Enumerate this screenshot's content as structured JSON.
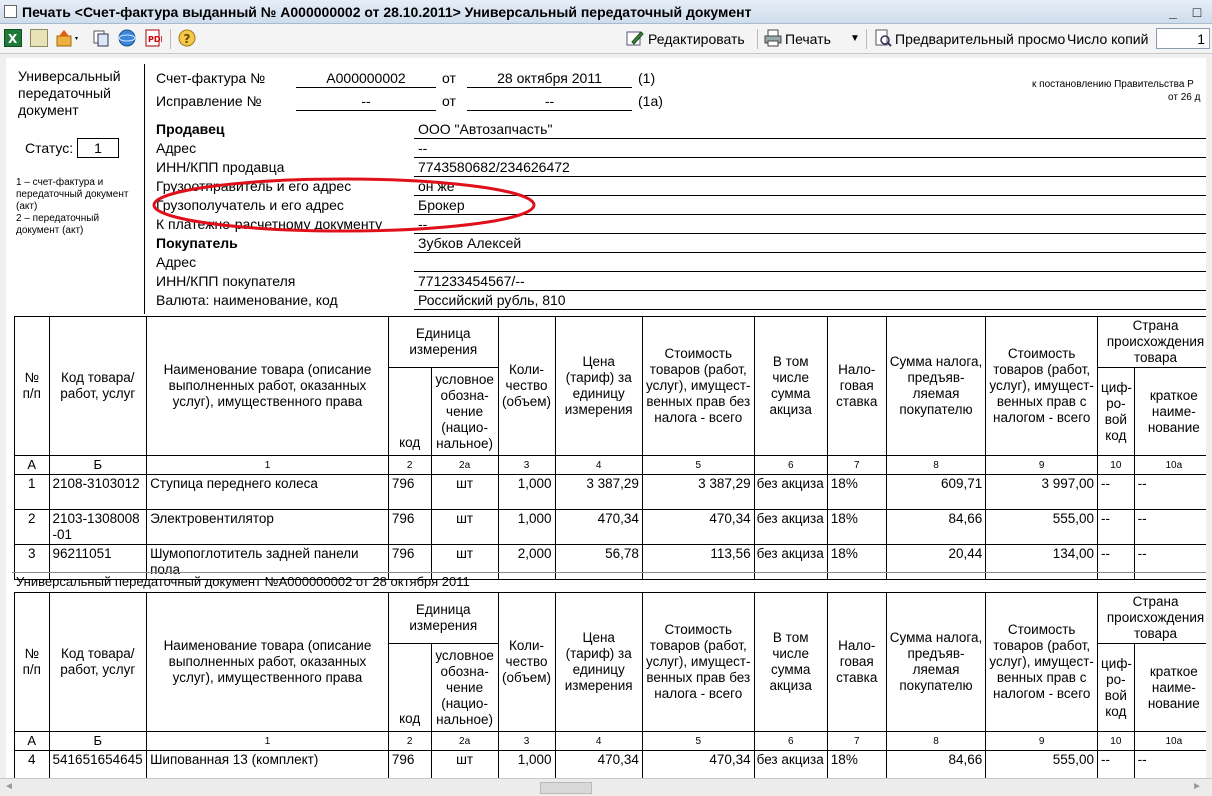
{
  "window": {
    "title": "Печать <Счет-фактура выданный № А000000002 от 28.10.2011> Универсальный передаточный документ"
  },
  "toolbar": {
    "edit_label": "Редактировать",
    "print_label": "Печать",
    "preview_label": "Предварительный просмо",
    "copies_label": "Число копий",
    "copies_value": "1"
  },
  "left": {
    "doc_type": [
      "Универсальный",
      "передаточный",
      "документ"
    ],
    "status_label": "Статус:",
    "status_value": "1",
    "note": [
      "1 – счет-фактура и",
      "передаточный документ",
      "(акт)",
      "2 – передаточный",
      "документ (акт)"
    ]
  },
  "header": {
    "invoice_label": "Счет-фактура №",
    "invoice_number": "А000000002",
    "from_label": "от",
    "invoice_date": "28 октября 2011",
    "num1": "(1)",
    "correction_label": "Исправление №",
    "correction_number": "--",
    "correction_from": "от",
    "correction_date": "--",
    "num1a": "(1а)",
    "gov_note_1": "к постановлению Правительства Р",
    "gov_note_2": "от 26 д"
  },
  "parties": [
    {
      "label": "Продавец",
      "value": "ООО \"Автозапчасть\"",
      "bold": true
    },
    {
      "label": "Адрес",
      "value": "--",
      "bold": false
    },
    {
      "label": "ИНН/КПП продавца",
      "value": "7743580682/234626472",
      "bold": false
    },
    {
      "label": "Грузоотправитель и его адрес",
      "value": "он же",
      "bold": false
    },
    {
      "label": "Грузополучатель и его адрес",
      "value": "Брокер",
      "bold": false
    },
    {
      "label": "К платежно-расчетному документу",
      "value": "--",
      "bold": false
    },
    {
      "label": "Покупатель",
      "value": "Зубков Алексей",
      "bold": true
    },
    {
      "label": "Адрес",
      "value": "",
      "bold": false
    },
    {
      "label": "ИНН/КПП покупателя",
      "value": "771233454567/--",
      "bold": false
    },
    {
      "label": "Валюта: наименование, код",
      "value": "Российский рубль, 810",
      "bold": false
    }
  ],
  "table_headers": {
    "num": "№ п/п",
    "code": "Код товара/ работ, услуг",
    "name": "Наименование товара (описание выполненных работ, оказанных услуг), имущественного права",
    "unit": "Единица измерения",
    "unit_code": "код",
    "unit_name": "условное обозна-чение (нацио-нальное)",
    "qty": "Коли-чество (объем)",
    "price": "Цена (тариф) за единицу измерения",
    "cost": "Стоимость товаров (работ, услуг), имущест-венных прав без налога - всего",
    "excise": "В том числе сумма акциза",
    "rate": "Нало-говая ставка",
    "tax": "Сумма налога, предъяв-ляемая покупателю",
    "total": "Стоимость товаров (работ, услуг), имущест-венных прав с налогом - всего",
    "country": "Страна происхождения товара",
    "country_code": "циф-ро-вой код",
    "country_name": "краткое наиме-нование",
    "col_index": [
      "А",
      "Б",
      "1",
      "2",
      "2а",
      "3",
      "4",
      "5",
      "6",
      "7",
      "8",
      "9",
      "10",
      "10а"
    ]
  },
  "rows_page1": [
    {
      "n": "1",
      "code": "2108-3103012",
      "name": "Ступица переднего колеса",
      "ucode": "796",
      "uname": "шт",
      "qty": "1,000",
      "price": "3 387,29",
      "cost": "3 387,29",
      "excise": "без акциза",
      "rate": "18%",
      "tax": "609,71",
      "total": "3 997,00",
      "cc": "--",
      "cn": "--"
    },
    {
      "n": "2",
      "code": "2103-1308008-01",
      "name": "Электровентилятор",
      "ucode": "796",
      "uname": "шт",
      "qty": "1,000",
      "price": "470,34",
      "cost": "470,34",
      "excise": "без акциза",
      "rate": "18%",
      "tax": "84,66",
      "total": "555,00",
      "cc": "--",
      "cn": "--"
    },
    {
      "n": "3",
      "code": "96211051",
      "name": "Шумопоглотитель задней панели пола",
      "ucode": "796",
      "uname": "шт",
      "qty": "2,000",
      "price": "56,78",
      "cost": "113,56",
      "excise": "без акциза",
      "rate": "18%",
      "tax": "20,44",
      "total": "134,00",
      "cc": "--",
      "cn": "--"
    }
  ],
  "page2_caption": "Универсальный передаточный документ №А000000002 от 28 октября 2011",
  "rows_page2": [
    {
      "n": "4",
      "code": "541651654645",
      "name": "Шипованная 13 (комплект)",
      "ucode": "796",
      "uname": "шт",
      "qty": "1,000",
      "price": "470,34",
      "cost": "470,34",
      "excise": "без акциза",
      "rate": "18%",
      "tax": "84,66",
      "total": "555,00",
      "cc": "--",
      "cn": "--"
    }
  ],
  "colors": {
    "highlight_ellipse": "#e0101a"
  }
}
